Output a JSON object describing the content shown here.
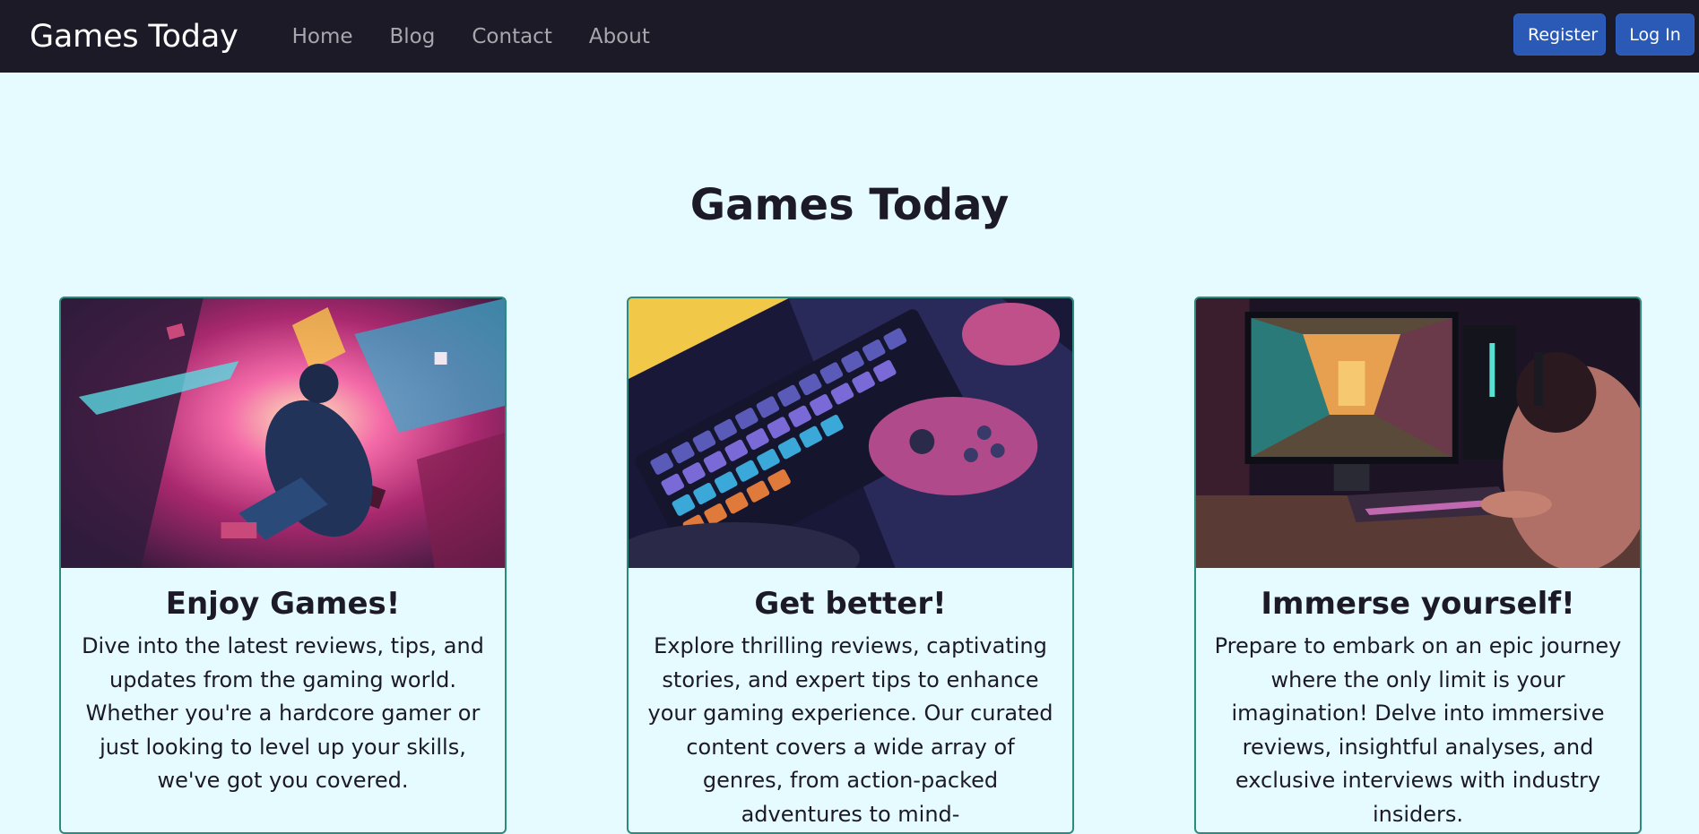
{
  "navbar": {
    "brand": "Games Today",
    "links": [
      "Home",
      "Blog",
      "Contact",
      "About"
    ],
    "register_label": "Register",
    "login_label": "Log In"
  },
  "hero": {
    "title": "Games Today"
  },
  "cards": [
    {
      "title": "Enjoy Games!",
      "text": "Dive into the latest reviews, tips, and updates from the gaming world. Whether you're a hardcore gamer or just looking to level up your skills, we've got you covered."
    },
    {
      "title": "Get better!",
      "text": "Explore thrilling reviews, captivating stories, and expert tips to enhance your gaming experience. Our curated content covers a wide array of genres, from action-packed adventures to mind-"
    },
    {
      "title": "Immerse yourself!",
      "text": "Prepare to embark on an epic journey where the only limit is your imagination! Delve into immersive reviews, insightful analyses, and exclusive interviews with industry insiders."
    }
  ],
  "colors": {
    "navbar_bg": "#1b1a26",
    "page_bg": "#e6fbff",
    "button_bg": "#2a5ab6",
    "card_border": "#2b8b7c"
  }
}
